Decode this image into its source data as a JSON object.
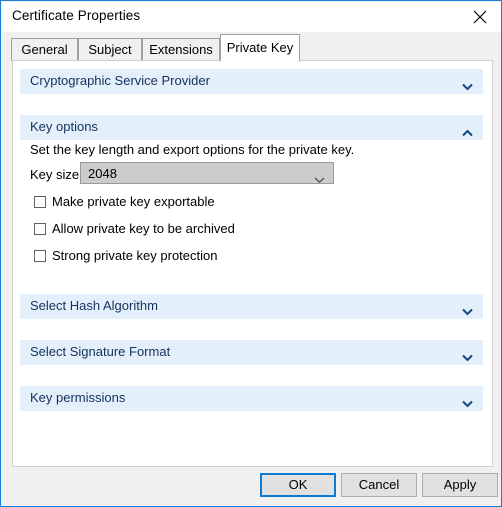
{
  "window": {
    "title": "Certificate Properties",
    "close_icon": "close-icon",
    "accent_color": "#1a7fd4",
    "header_bg": "#e3f0fb",
    "header_text_color": "#16315c"
  },
  "tabs": [
    {
      "label": "General",
      "active": false
    },
    {
      "label": "Subject",
      "active": false
    },
    {
      "label": "Extensions",
      "active": false
    },
    {
      "label": "Private Key",
      "active": true
    }
  ],
  "sections": [
    {
      "label": "Cryptographic Service Provider",
      "expanded": false,
      "chevron": "chevron-down-icon"
    },
    {
      "label": "Key options",
      "expanded": true,
      "chevron": "chevron-up-icon"
    },
    {
      "label": "Select Hash Algorithm",
      "expanded": false,
      "chevron": "chevron-down-icon"
    },
    {
      "label": "Select Signature Format",
      "expanded": false,
      "chevron": "chevron-down-icon"
    },
    {
      "label": "Key permissions",
      "expanded": false,
      "chevron": "chevron-down-icon"
    }
  ],
  "key_options": {
    "description": "Set the key length and export options for the private key.",
    "key_size_label": "Key size:",
    "key_size_value": "2048",
    "key_size_arrow": "chevron-down-icon",
    "checkboxes": [
      {
        "label": "Make private key exportable",
        "checked": false
      },
      {
        "label": "Allow private key to be archived",
        "checked": false
      },
      {
        "label": "Strong private key protection",
        "checked": false
      }
    ]
  },
  "footer": {
    "ok_label": "OK",
    "cancel_label": "Cancel",
    "apply_label": "Apply"
  }
}
